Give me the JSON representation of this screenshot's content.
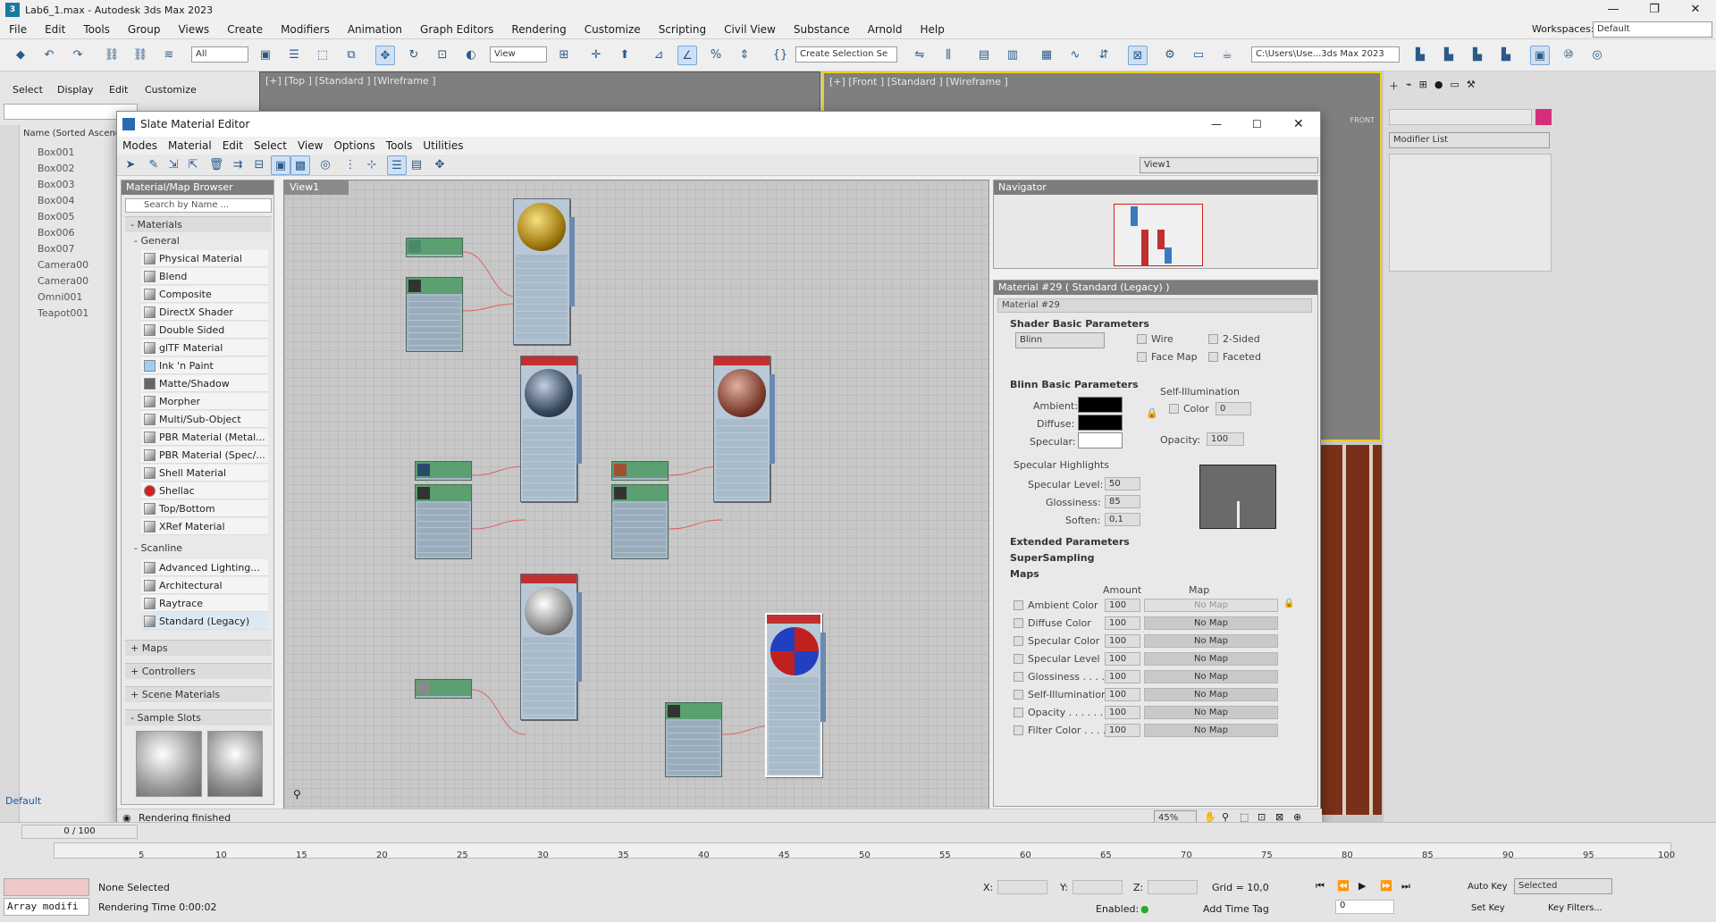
{
  "window": {
    "title": "Lab6_1.max - Autodesk 3ds Max 2023"
  },
  "menu": [
    "File",
    "Edit",
    "Tools",
    "Group",
    "Views",
    "Create",
    "Modifiers",
    "Animation",
    "Graph Editors",
    "Rendering",
    "Customize",
    "Scripting",
    "Civil View",
    "Substance",
    "Arnold",
    "Help"
  ],
  "workspaces": {
    "label": "Workspaces:",
    "value": "Default"
  },
  "toolbar": {
    "filter": "All",
    "refcoord": "View",
    "selset": "Create Selection Se",
    "path": "C:\\Users\\Use...3ds Max 2023"
  },
  "scene_explorer": {
    "tabs": [
      "Select",
      "Display",
      "Edit",
      "Customize"
    ],
    "column": "Name (Sorted Ascend",
    "items": [
      "Box001",
      "Box002",
      "Box003",
      "Box004",
      "Box005",
      "Box006",
      "Box007",
      "Camera00",
      "Camera00",
      "Omni001",
      "Teapot001"
    ],
    "layer": "Default"
  },
  "viewports": {
    "top": "[+] [Top ] [Standard ] [Wireframe ]",
    "front": "[+] [Front ] [Standard ] [Wireframe ]",
    "cube": "FRONT"
  },
  "command_panel": {
    "modifier_list": "Modifier List"
  },
  "sme": {
    "title": "Slate Material Editor",
    "menu": [
      "Modes",
      "Material",
      "Edit",
      "Select",
      "View",
      "Options",
      "Tools",
      "Utilities"
    ],
    "view_select": "View1",
    "browser": {
      "title": "Material/Map Browser",
      "search": "Search by Name ...",
      "materials": "- Materials",
      "general": "- General",
      "general_items": [
        "Physical Material",
        "Blend",
        "Composite",
        "DirectX Shader",
        "Double Sided",
        "glTF Material",
        "Ink 'n Paint",
        "Matte/Shadow",
        "Morpher",
        "Multi/Sub-Object",
        "PBR Material (Metal...",
        "PBR Material (Spec/...",
        "Shell Material",
        "Shellac",
        "Top/Bottom",
        "XRef Material"
      ],
      "scanline": "- Scanline",
      "scanline_items": [
        "Advanced Lighting...",
        "Architectural",
        "Raytrace",
        "Standard (Legacy)"
      ],
      "groups": [
        "+ Maps",
        "+ Controllers",
        "+ Scene Materials",
        "- Sample Slots"
      ]
    },
    "view_tab": "View1",
    "navigator": "Navigator",
    "param_title": "Material #29  ( Standard (Legacy) )",
    "material_name": "Material #29",
    "shader_rollout": "Shader Basic Parameters",
    "shader": "Blinn",
    "shader_checks": [
      "Wire",
      "2-Sided",
      "Face Map",
      "Faceted"
    ],
    "blinn_rollout": "Blinn Basic Parameters",
    "ambient": "Ambient:",
    "diffuse": "Diffuse:",
    "specular": "Specular:",
    "self_illum": "Self-Illumination",
    "color_label": "Color",
    "color_val": "0",
    "opacity_label": "Opacity:",
    "opacity_val": "100",
    "spec_hl": "Specular Highlights",
    "spec_level": {
      "label": "Specular Level:",
      "value": "50"
    },
    "gloss": {
      "label": "Glossiness:",
      "value": "85"
    },
    "soften": {
      "label": "Soften:",
      "value": "0,1"
    },
    "extended": "Extended Parameters",
    "supersampling": "SuperSampling",
    "maps": "Maps",
    "maps_amount": "Amount",
    "maps_map": "Map",
    "map_rows": [
      {
        "name": "Ambient Color",
        "amount": "100",
        "map": "No Map"
      },
      {
        "name": "Diffuse Color",
        "amount": "100",
        "map": "No Map"
      },
      {
        "name": "Specular Color",
        "amount": "100",
        "map": "No Map"
      },
      {
        "name": "Specular Level",
        "amount": "100",
        "map": "No Map"
      },
      {
        "name": "Glossiness . . . .",
        "amount": "100",
        "map": "No Map"
      },
      {
        "name": "Self-Illumination",
        "amount": "100",
        "map": "No Map"
      },
      {
        "name": "Opacity . . . . . .",
        "amount": "100",
        "map": "No Map"
      },
      {
        "name": "Filter Color . . . .",
        "amount": "100",
        "map": "No Map"
      }
    ],
    "status": "Rendering finished",
    "zoom": "45%"
  },
  "timeline": {
    "frame": "0 / 100",
    "ticks": [
      "5",
      "10",
      "15",
      "20",
      "25",
      "30",
      "35",
      "40",
      "45",
      "50",
      "55",
      "60",
      "65",
      "70",
      "75",
      "80",
      "85",
      "90",
      "95",
      "100"
    ]
  },
  "status": {
    "selection": "None Selected",
    "render_time": "Rendering Time  0:00:02",
    "script": "Array modifi",
    "x": "X:",
    "y": "Y:",
    "z": "Z:",
    "grid": "Grid = 10,0",
    "enabled": "Enabled:",
    "add_time_tag": "Add Time Tag",
    "auto_key": "Auto Key",
    "selected": "Selected",
    "set_key": "Set Key",
    "key_filters": "Key Filters...",
    "frame": "0"
  }
}
